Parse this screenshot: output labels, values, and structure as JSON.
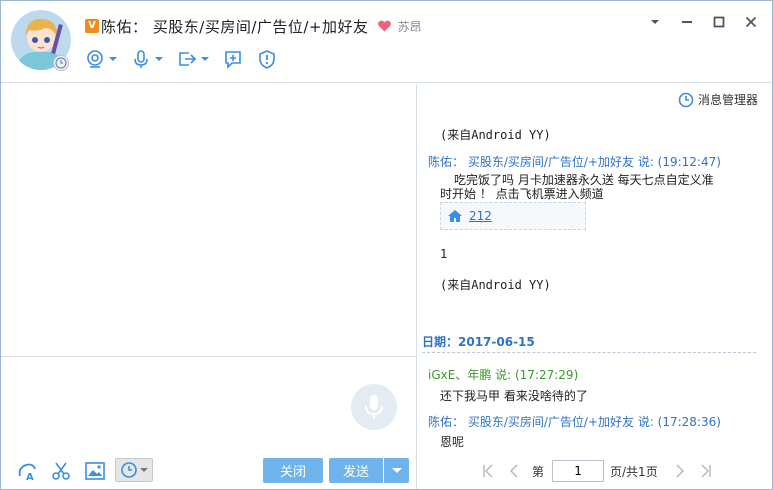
{
  "header": {
    "vip_badge": "V",
    "contact_name": "陈佑： 买股东/买房间/广告位/+加好友",
    "signature": "苏昂",
    "accent_color": "#3a8ee6",
    "toolbar_icons": [
      "video-call-icon",
      "voice-call-icon",
      "transfer-file-icon",
      "add-contact-icon",
      "shield-icon"
    ],
    "window_controls": [
      "dropdown-icon",
      "minimize-icon",
      "maximize-icon",
      "close-icon"
    ]
  },
  "input": {
    "close_label": "关闭",
    "send_label": "发送",
    "bottom_tools": [
      "font-icon",
      "scissors-icon",
      "image-icon",
      "history-icon"
    ],
    "button_color": "#6fb3ec"
  },
  "history": {
    "manager_label": "消息管理器",
    "messages": [
      {
        "text": "(来自Android YY)"
      },
      {
        "sender": "陈佑： 买股东/买房间/广告位/+加好友 说: (19:12:47)",
        "line1": "吃完饭了吗  月卡加速器永久送  每天七点自定义准",
        "line2": "时开始  ！  点击飞机票进入频道",
        "channel_num": "212",
        "extra": "1",
        "source": "(来自Android YY)"
      }
    ],
    "date_label": "日期：2017-06-15",
    "messages_2": [
      {
        "sender": "iGxE、年鹏 说: (17:27:29)",
        "text": "还下我马甲 看来没啥待的了"
      },
      {
        "sender": "陈佑： 买股东/买房间/广告位/+加好友 说: (17:28:36)",
        "text": "恩呢"
      }
    ]
  },
  "pager": {
    "page_label": "第",
    "page_value": "1",
    "total_label": "页/共1页"
  }
}
